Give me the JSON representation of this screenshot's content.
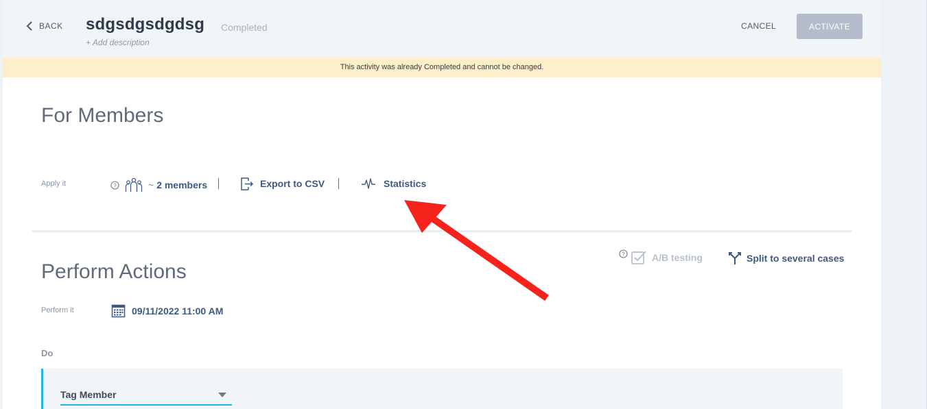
{
  "header": {
    "back_label": "BACK",
    "title": "sdgsdgsdgdsg",
    "status": "Completed",
    "add_description": "+ Add description",
    "cancel_label": "CANCEL",
    "activate_label": "ACTIVATE"
  },
  "banner": {
    "text": "This activity was already Completed and cannot be changed."
  },
  "for_members": {
    "title": "For Members",
    "apply_label": "Apply it",
    "members_tilde": "~",
    "members_count": "2 members",
    "export_label": "Export to CSV",
    "statistics_label": "Statistics"
  },
  "perform_actions": {
    "title": "Perform Actions",
    "ab_testing_label": "A/B testing",
    "split_label": "Split to several cases",
    "perform_label": "Perform it",
    "datetime": "09/11/2022 11:00 AM",
    "do_label": "Do",
    "action_select": "Tag Member"
  },
  "colors": {
    "accent": "#3e5880",
    "highlight_border": "#25b6e0",
    "banner_bg": "#fdeecc",
    "annotation_arrow": "#f5231c"
  }
}
